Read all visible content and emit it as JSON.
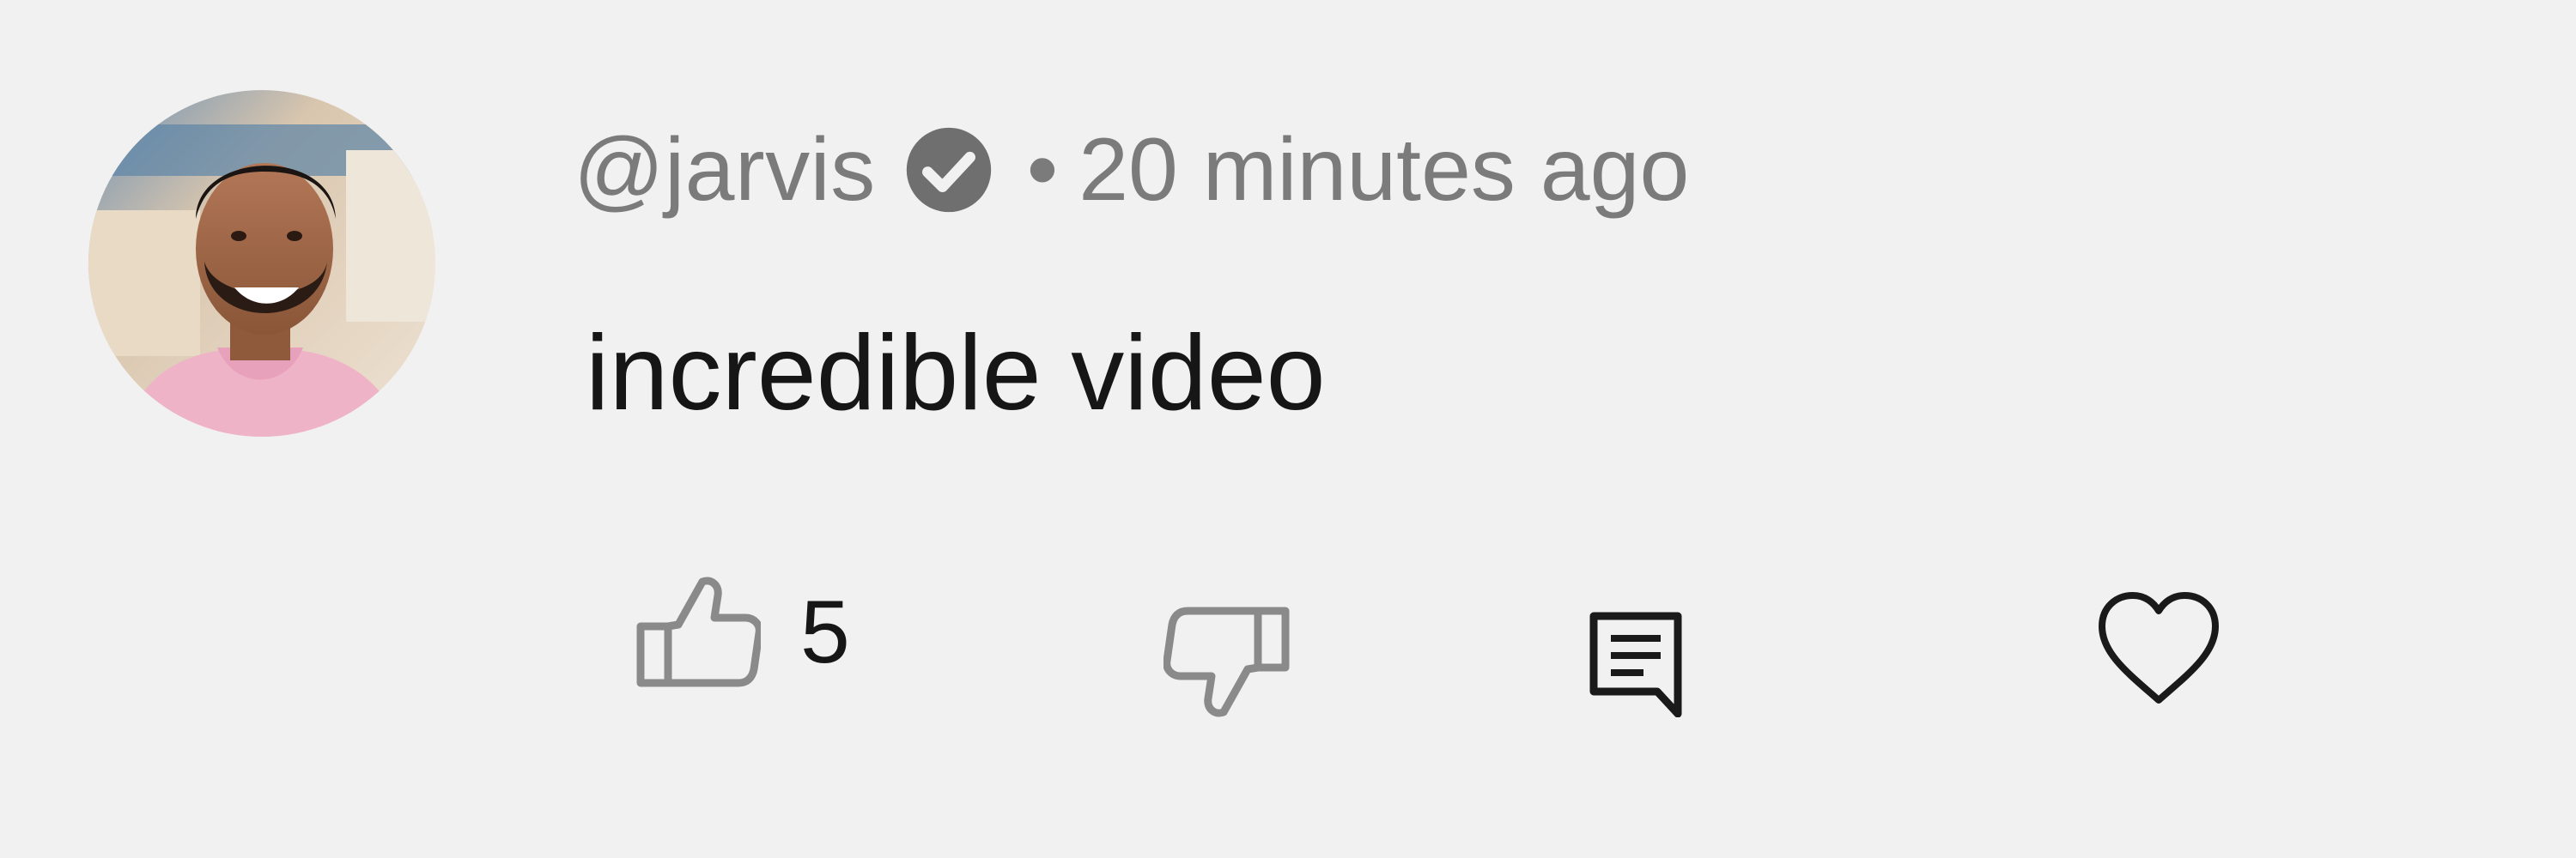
{
  "comment": {
    "author": "@jarvis",
    "separator": "•",
    "time": "20 minutes ago",
    "text": "incredible video",
    "like_count": "5"
  },
  "icons": {
    "verified": "verified-check-icon",
    "like": "thumbs-up-icon",
    "dislike": "thumbs-down-icon",
    "reply": "reply-comment-icon",
    "heart": "heart-icon"
  },
  "colors": {
    "background": "#f1f1f1",
    "meta_text": "#7b7b7b",
    "body_text": "#161616",
    "icon_gray": "#8a8a8a"
  }
}
